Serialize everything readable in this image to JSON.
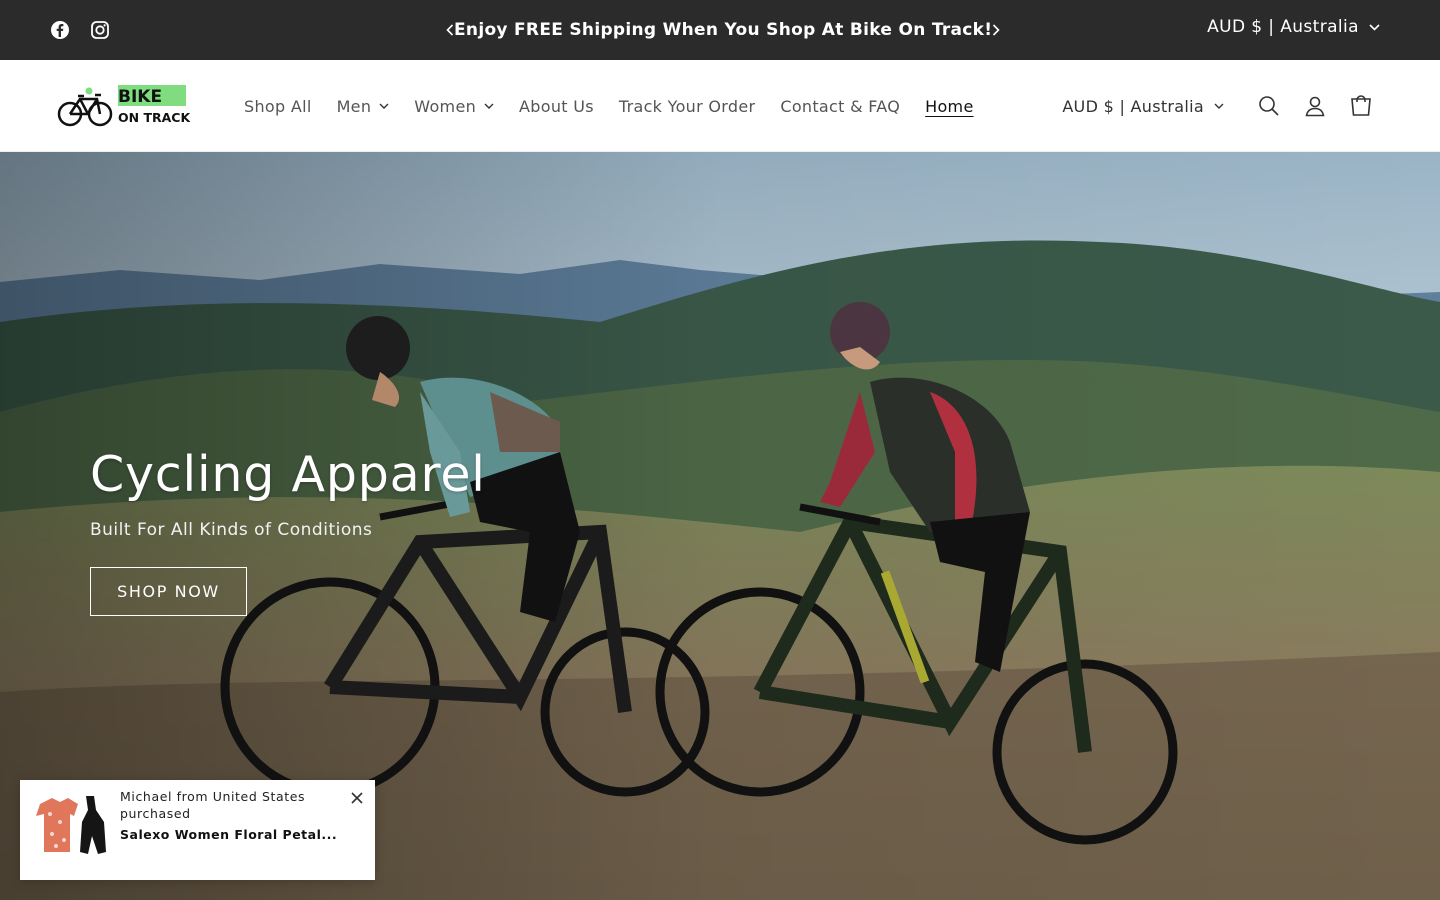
{
  "announcement": {
    "text": "Enjoy FREE Shipping When You Shop At Bike On Track!",
    "prev_icon": "chevron-left-icon",
    "next_icon": "chevron-right-icon"
  },
  "social": [
    {
      "name": "facebook",
      "icon": "facebook-icon"
    },
    {
      "name": "instagram",
      "icon": "instagram-icon"
    }
  ],
  "country_selector_top": "AUD $ | Australia",
  "logo": {
    "line1": "BIKE",
    "line2": "ON TRACK"
  },
  "nav": [
    {
      "label": "Shop All",
      "dropdown": false
    },
    {
      "label": "Men",
      "dropdown": true
    },
    {
      "label": "Women",
      "dropdown": true
    },
    {
      "label": "About Us",
      "dropdown": false
    },
    {
      "label": "Track Your Order",
      "dropdown": false
    },
    {
      "label": "Contact & FAQ",
      "dropdown": false
    },
    {
      "label": "Home",
      "dropdown": false,
      "active": true
    }
  ],
  "country_selector_header": "AUD $ | Australia",
  "header_icons": [
    "search-icon",
    "account-icon",
    "cart-icon"
  ],
  "hero": {
    "title": "Cycling Apparel",
    "subtitle": "Built For All Kinds of Conditions",
    "button": "SHOP NOW"
  },
  "popup": {
    "buyer": "Michael from United States purchased",
    "product": "Salexo Women Floral Petal..."
  },
  "colors": {
    "announcement_bg": "#2b2b2b",
    "logo_accent": "#7fdc7f"
  }
}
